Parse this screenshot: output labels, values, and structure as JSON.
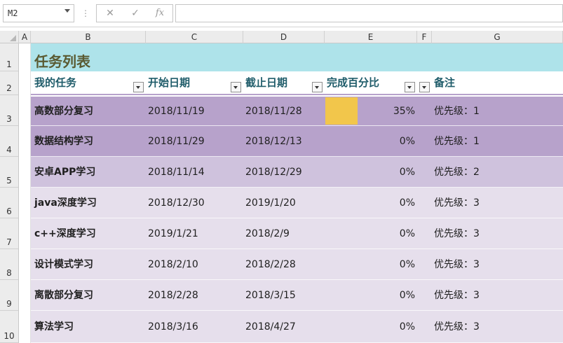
{
  "formula_bar": {
    "name_box": "M2",
    "cancel_icon": "✕",
    "enter_icon": "✓",
    "fx_label": "fx",
    "formula": ""
  },
  "columns": [
    "A",
    "B",
    "C",
    "D",
    "E",
    "F",
    "G"
  ],
  "rows": [
    "1",
    "2",
    "3",
    "4",
    "5",
    "6",
    "7",
    "8",
    "9",
    "10"
  ],
  "title": "任务列表",
  "headers": {
    "task": "我的任务",
    "start": "开始日期",
    "end": "截止日期",
    "percent": "完成百分比",
    "note": "备注"
  },
  "tasks": [
    {
      "name": "高数部分复习",
      "start": "2018/11/19",
      "end": "2018/11/28",
      "percent": "35%",
      "progress": 0.35,
      "note": "优先级：1"
    },
    {
      "name": "数据结构学习",
      "start": "2018/11/29",
      "end": "2018/12/13",
      "percent": "0%",
      "progress": 0,
      "note": "优先级：1"
    },
    {
      "name": "安卓APP学习",
      "start": "2018/11/14",
      "end": "2018/12/29",
      "percent": "0%",
      "progress": 0,
      "note": "优先级：2"
    },
    {
      "name": "java深度学习",
      "start": "2018/12/30",
      "end": "2019/1/20",
      "percent": "0%",
      "progress": 0,
      "note": "优先级：3"
    },
    {
      "name": "c++深度学习",
      "start": "2019/1/21",
      "end": "2018/2/9",
      "percent": "0%",
      "progress": 0,
      "note": "优先级：3"
    },
    {
      "name": "设计模式学习",
      "start": "2018/2/10",
      "end": "2018/2/28",
      "percent": "0%",
      "progress": 0,
      "note": "优先级：3"
    },
    {
      "name": "离散部分复习",
      "start": "2018/2/28",
      "end": "2018/3/15",
      "percent": "0%",
      "progress": 0,
      "note": "优先级：3"
    },
    {
      "name": "算法学习",
      "start": "2018/3/16",
      "end": "2018/4/27",
      "percent": "0%",
      "progress": 0,
      "note": "优先级：3"
    }
  ],
  "colors": {
    "title_band": "#aee3ea",
    "priority1": "#b7a2cb",
    "priority2": "#cfc2dd",
    "priority3": "#e6dfec",
    "progress_bar": "#f2c64b",
    "header_text": "#1f5c6a",
    "title_text": "#5a5a32"
  }
}
